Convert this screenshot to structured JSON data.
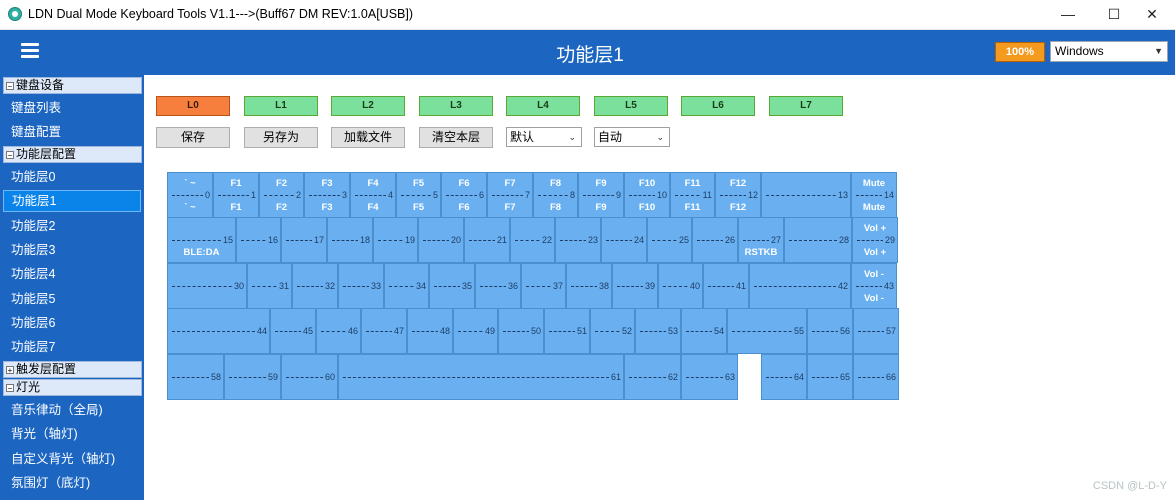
{
  "window": {
    "title": "LDN Dual Mode Keyboard Tools V1.1--->(Buff67 DM REV:1.0A[USB])",
    "min": "—",
    "max": "☐",
    "close": "✕"
  },
  "header": {
    "title": "功能层1",
    "zoom": "100%",
    "os": "Windows"
  },
  "sidebar": {
    "sections": [
      {
        "label": "键盘设备",
        "expanded": true,
        "items": [
          "键盘列表",
          "键盘配置"
        ]
      },
      {
        "label": "功能层配置",
        "expanded": true,
        "items": [
          "功能层0",
          "功能层1",
          "功能层2",
          "功能层3",
          "功能层4",
          "功能层5",
          "功能层6",
          "功能层7"
        ]
      },
      {
        "label": "触发层配置",
        "expanded": false,
        "items": []
      },
      {
        "label": "灯光",
        "expanded": true,
        "items": [
          "音乐律动（全局)",
          "背光（轴灯)",
          "自定义背光（轴灯)",
          "氛围灯（底灯)"
        ]
      }
    ],
    "selected": "功能层1"
  },
  "layers": [
    "L0",
    "L1",
    "L2",
    "L3",
    "L4",
    "L5",
    "L6",
    "L7"
  ],
  "active_layer": "L0",
  "actions": {
    "save": "保存",
    "save_as": "另存为",
    "load": "加载文件",
    "clear": "清空本层"
  },
  "selects": {
    "mode": "默认",
    "auto": "自动"
  },
  "keyboard": {
    "rows": [
      [
        {
          "idx": "0",
          "top": "` ~",
          "bot": "` ~"
        },
        {
          "idx": "1",
          "top": "F1",
          "bot": "F1"
        },
        {
          "idx": "2",
          "top": "F2",
          "bot": "F2"
        },
        {
          "idx": "3",
          "top": "F3",
          "bot": "F3"
        },
        {
          "idx": "4",
          "top": "F4",
          "bot": "F4"
        },
        {
          "idx": "5",
          "top": "F5",
          "bot": "F5"
        },
        {
          "idx": "6",
          "top": "F6",
          "bot": "F6"
        },
        {
          "idx": "7",
          "top": "F7",
          "bot": "F7"
        },
        {
          "idx": "8",
          "top": "F8",
          "bot": "F8"
        },
        {
          "idx": "9",
          "top": "F9",
          "bot": "F9"
        },
        {
          "idx": "10",
          "top": "F10",
          "bot": "F10"
        },
        {
          "idx": "11",
          "top": "F11",
          "bot": "F11"
        },
        {
          "idx": "12",
          "top": "F12",
          "bot": "F12"
        },
        {
          "idx": "13",
          "top": "",
          "bot": ""
        },
        {
          "idx": "14",
          "top": "Mute",
          "bot": "Mute"
        }
      ],
      [
        {
          "idx": "15",
          "top": "",
          "bot": "BLE:DA"
        },
        {
          "idx": "16",
          "top": "",
          "bot": ""
        },
        {
          "idx": "17",
          "top": "",
          "bot": ""
        },
        {
          "idx": "18",
          "top": "",
          "bot": ""
        },
        {
          "idx": "19",
          "top": "",
          "bot": ""
        },
        {
          "idx": "20",
          "top": "",
          "bot": ""
        },
        {
          "idx": "21",
          "top": "",
          "bot": ""
        },
        {
          "idx": "22",
          "top": "",
          "bot": ""
        },
        {
          "idx": "23",
          "top": "",
          "bot": ""
        },
        {
          "idx": "24",
          "top": "",
          "bot": ""
        },
        {
          "idx": "25",
          "top": "",
          "bot": ""
        },
        {
          "idx": "26",
          "top": "",
          "bot": ""
        },
        {
          "idx": "27",
          "top": "",
          "bot": "RSTKB"
        },
        {
          "idx": "28",
          "top": "",
          "bot": ""
        },
        {
          "idx": "29",
          "top": "Vol +",
          "bot": "Vol +"
        }
      ],
      [
        {
          "idx": "30",
          "top": "",
          "bot": ""
        },
        {
          "idx": "31",
          "top": "",
          "bot": ""
        },
        {
          "idx": "32",
          "top": "",
          "bot": ""
        },
        {
          "idx": "33",
          "top": "",
          "bot": ""
        },
        {
          "idx": "34",
          "top": "",
          "bot": ""
        },
        {
          "idx": "35",
          "top": "",
          "bot": ""
        },
        {
          "idx": "36",
          "top": "",
          "bot": ""
        },
        {
          "idx": "37",
          "top": "",
          "bot": ""
        },
        {
          "idx": "38",
          "top": "",
          "bot": ""
        },
        {
          "idx": "39",
          "top": "",
          "bot": ""
        },
        {
          "idx": "40",
          "top": "",
          "bot": ""
        },
        {
          "idx": "41",
          "top": "",
          "bot": ""
        },
        {
          "idx": "42",
          "top": "",
          "bot": ""
        },
        {
          "idx": "43",
          "top": "Vol -",
          "bot": "Vol -"
        }
      ],
      [
        {
          "idx": "44",
          "top": "",
          "bot": ""
        },
        {
          "idx": "45",
          "top": "",
          "bot": ""
        },
        {
          "idx": "46",
          "top": "",
          "bot": ""
        },
        {
          "idx": "47",
          "top": "",
          "bot": ""
        },
        {
          "idx": "48",
          "top": "",
          "bot": ""
        },
        {
          "idx": "49",
          "top": "",
          "bot": ""
        },
        {
          "idx": "50",
          "top": "",
          "bot": ""
        },
        {
          "idx": "51",
          "top": "",
          "bot": ""
        },
        {
          "idx": "52",
          "top": "",
          "bot": ""
        },
        {
          "idx": "53",
          "top": "",
          "bot": ""
        },
        {
          "idx": "54",
          "top": "",
          "bot": ""
        },
        {
          "idx": "55",
          "top": "",
          "bot": ""
        },
        {
          "idx": "56",
          "top": "",
          "bot": ""
        },
        {
          "idx": "57",
          "top": "",
          "bot": ""
        }
      ],
      [
        {
          "idx": "58",
          "top": "",
          "bot": ""
        },
        {
          "idx": "59",
          "top": "",
          "bot": ""
        },
        {
          "idx": "60",
          "top": "",
          "bot": ""
        },
        {
          "idx": "61",
          "top": "",
          "bot": ""
        },
        {
          "idx": "62",
          "top": "",
          "bot": ""
        },
        {
          "idx": "63",
          "top": "",
          "bot": ""
        },
        {
          "idx": "64",
          "top": "",
          "bot": ""
        },
        {
          "idx": "65",
          "top": "",
          "bot": ""
        },
        {
          "idx": "66",
          "top": "",
          "bot": ""
        }
      ]
    ]
  },
  "watermark": "CSDN @L-D-Y"
}
